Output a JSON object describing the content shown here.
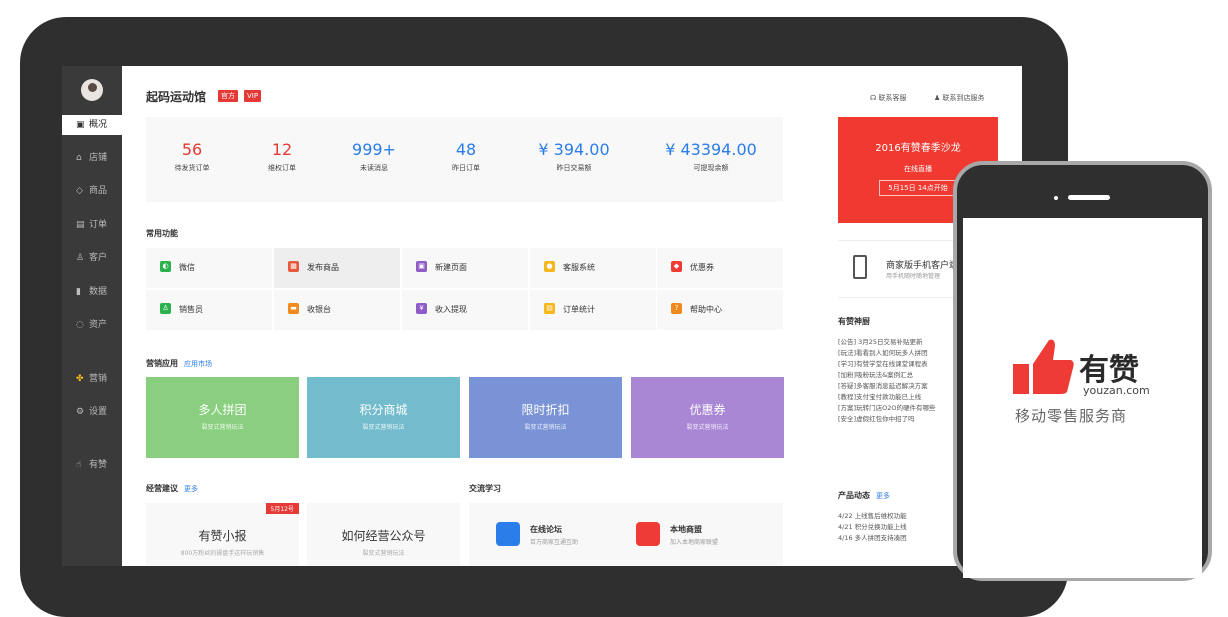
{
  "shop": {
    "name": "起码运动馆",
    "badge_official": "官方",
    "badge_vip": "VIP"
  },
  "top_links": {
    "support": "联系客服",
    "store_service": "联系到店服务"
  },
  "sidebar": {
    "items": [
      {
        "label": "概况",
        "icon": "dashboard-icon"
      },
      {
        "label": "店铺",
        "icon": "store-icon"
      },
      {
        "label": "商品",
        "icon": "tag-icon"
      },
      {
        "label": "订单",
        "icon": "order-icon"
      },
      {
        "label": "客户",
        "icon": "user-icon"
      },
      {
        "label": "数据",
        "icon": "chart-icon"
      },
      {
        "label": "资产",
        "icon": "wallet-icon"
      },
      {
        "label": "营销",
        "icon": "apps-icon"
      },
      {
        "label": "设置",
        "icon": "gear-icon"
      },
      {
        "label": "有赞",
        "icon": "thumbs-up-icon"
      }
    ]
  },
  "stats": [
    {
      "value": "56",
      "label": "待发货订单"
    },
    {
      "value": "12",
      "label": "维权订单"
    },
    {
      "value": "999+",
      "label": "未读消息"
    },
    {
      "value": "48",
      "label": "昨日订单"
    },
    {
      "value": "¥ 394.00",
      "label": "昨日交易额"
    },
    {
      "value": "¥ 43394.00",
      "label": "可提现余额"
    }
  ],
  "common": {
    "title": "常用功能",
    "items": [
      {
        "label": "微信",
        "color": "#2bb24c",
        "icon": "wechat-icon"
      },
      {
        "label": "发布商品",
        "color": "#e8583d",
        "icon": "publish-icon"
      },
      {
        "label": "新建页面",
        "color": "#8e5bc7",
        "icon": "page-icon"
      },
      {
        "label": "客服系统",
        "color": "#f5b81c",
        "icon": "chat-icon"
      },
      {
        "label": "优惠券",
        "color": "#ef3b35",
        "icon": "coupon-icon"
      },
      {
        "label": "销售员",
        "color": "#2bb24c",
        "icon": "salesperson-icon"
      },
      {
        "label": "收银台",
        "color": "#f08a1e",
        "icon": "cashier-icon"
      },
      {
        "label": "收入提现",
        "color": "#8e5bc7",
        "icon": "yen-icon"
      },
      {
        "label": "订单统计",
        "color": "#f5b81c",
        "icon": "stats-icon"
      },
      {
        "label": "帮助中心",
        "color": "#f08a1e",
        "icon": "help-icon"
      }
    ]
  },
  "marketing": {
    "title": "营销应用",
    "link": "应用市场",
    "cards": [
      {
        "title": "多人拼团",
        "sub": "裂变式营销玩法",
        "color": "#8acf7f"
      },
      {
        "title": "积分商城",
        "sub": "裂变式营销玩法",
        "color": "#73bccd"
      },
      {
        "title": "限时折扣",
        "sub": "裂变式营销玩法",
        "color": "#7993d6"
      },
      {
        "title": "优惠券",
        "sub": "裂变式营销玩法",
        "color": "#a987d5"
      }
    ]
  },
  "advice": {
    "title": "经营建议",
    "link": "更多",
    "cards": [
      {
        "title": "有赞小报",
        "sub": "800万粉丝的操盘手这样玩销售",
        "ribbon": "5月12号"
      },
      {
        "title": "如何经营公众号",
        "sub": "裂变式营销玩法"
      }
    ]
  },
  "learning": {
    "title": "交流学习",
    "items": [
      {
        "title": "在线论坛",
        "sub": "百万商家互通互助",
        "color": "#2b7de9"
      },
      {
        "title": "本地商盟",
        "sub": "加入本地商家联盟",
        "color": "#ef3b35"
      }
    ]
  },
  "promo": {
    "title": "2016有赞春季沙龙",
    "sub": "在线直播",
    "date": "5月15日 14点开始"
  },
  "app_box": {
    "title": "商家版手机客户端",
    "sub": "用手机随时随地管理"
  },
  "news": {
    "title": "有赞神厨",
    "items": [
      "[公告] 3月25日交易补贴更新",
      "[玩法]看看别人如何玩多人拼团",
      "[学习]有赞学堂在线课堂课程表",
      "[加粉]吸粉玩法&案例汇总",
      "[答疑]多客服消息延迟解决方案",
      "[教程]支付宝付款功能已上线",
      "[方案]玩转门店O2O的硬件有哪些",
      "[安全]虚假红包你中招了吗"
    ]
  },
  "product_news": {
    "title": "产品动态",
    "link": "更多",
    "items": [
      "4/22 上线售后维权功能",
      "4/21 积分兑换功能上线",
      "4/16 多人拼团支持凑团"
    ]
  },
  "phone": {
    "brand": "有赞",
    "domain": "youzan.com",
    "slogan": "移动零售服务商",
    "brand_color": "#ef3b35"
  }
}
